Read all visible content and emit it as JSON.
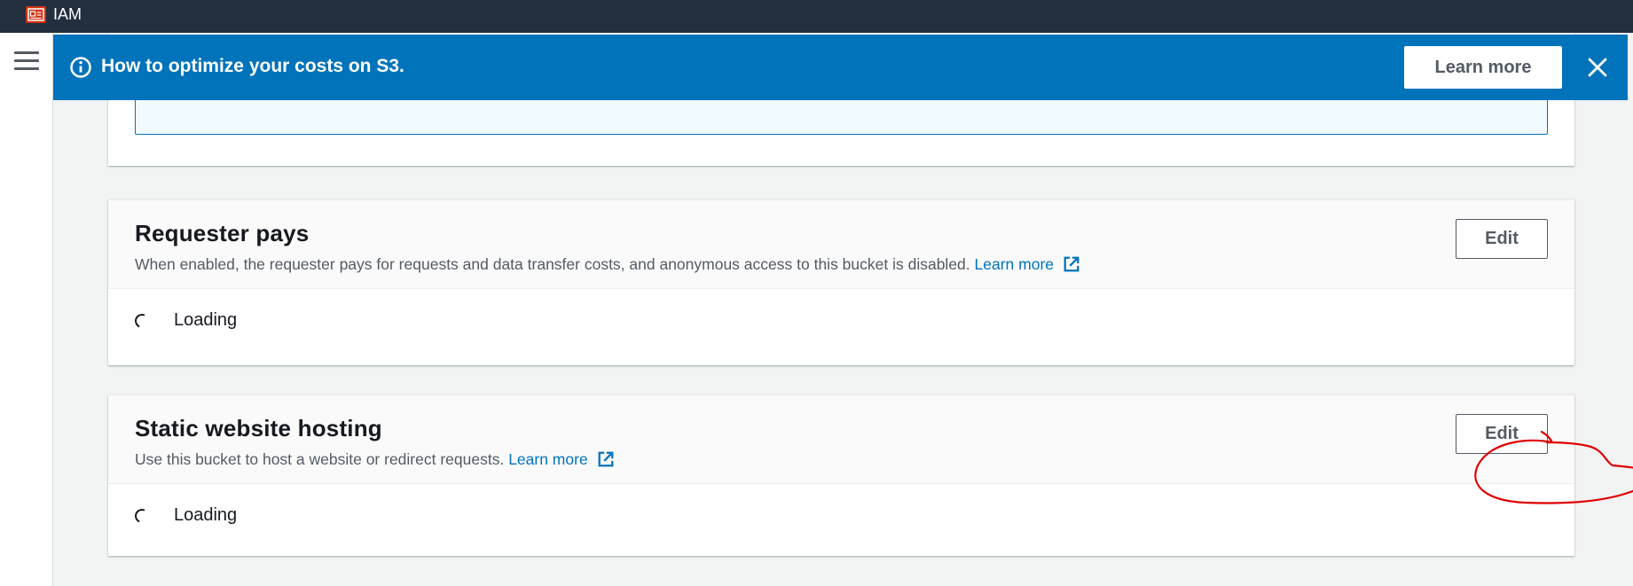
{
  "topbar": {
    "service_name": "IAM",
    "service_icon": "iam-service-icon"
  },
  "flashbar": {
    "message": "How to optimize your costs on S3.",
    "learn_more_label": "Learn more",
    "info_icon": "info-circle-icon",
    "close_icon": "close-icon"
  },
  "requester_pays": {
    "title": "Requester pays",
    "description": "When enabled, the requester pays for requests and data transfer costs, and anonymous access to this bucket is disabled.",
    "learn_more_label": "Learn more",
    "edit_label": "Edit",
    "loading_text": "Loading"
  },
  "static_website_hosting": {
    "title": "Static website hosting",
    "description": "Use this bucket to host a website or redirect requests.",
    "learn_more_label": "Learn more",
    "edit_label": "Edit",
    "loading_text": "Loading"
  },
  "colors": {
    "topbar_bg": "#232f3e",
    "flashbar_bg": "#0073bb",
    "link": "#0073bb",
    "annotation": "#e00000"
  }
}
